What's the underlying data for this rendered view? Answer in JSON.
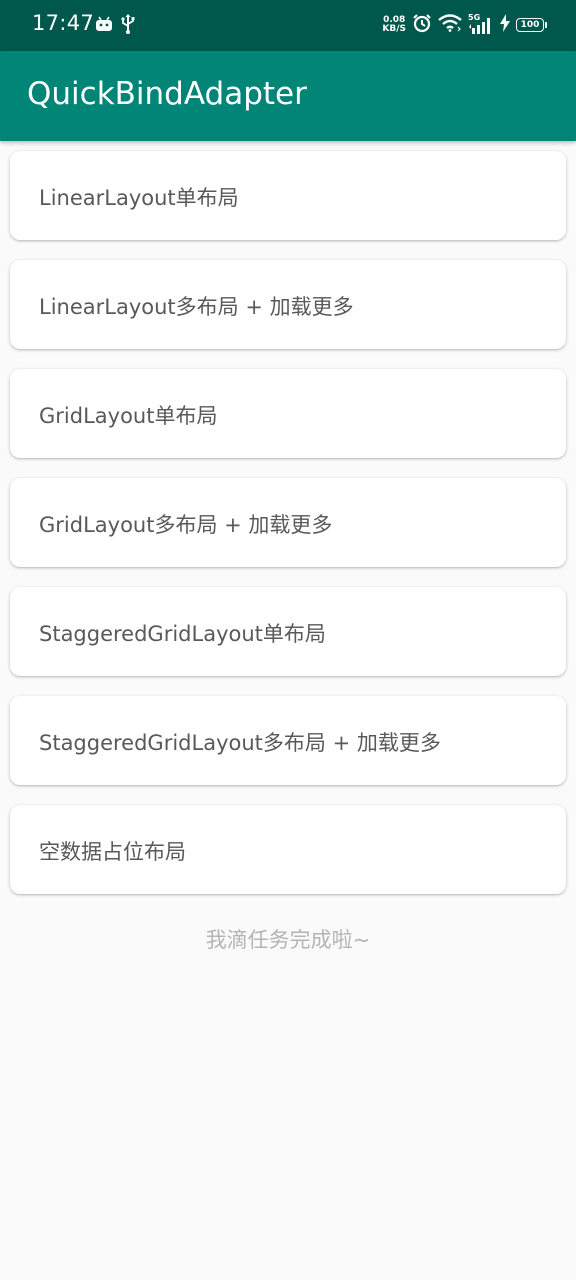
{
  "status_bar": {
    "time": "17:47",
    "net_speed_value": "0.08",
    "net_speed_unit": "KB/S",
    "network_type": "5G",
    "battery_level": "100",
    "icons": [
      "android-notification-icon",
      "usb-icon",
      "alarm-icon",
      "wifi-icon",
      "signal-icon",
      "charging-icon",
      "battery-icon"
    ]
  },
  "app_bar": {
    "title": "QuickBindAdapter"
  },
  "menu": {
    "items": [
      {
        "label": "LinearLayout单布局"
      },
      {
        "label": "LinearLayout多布局 + 加载更多"
      },
      {
        "label": "GridLayout单布局"
      },
      {
        "label": "GridLayout多布局 + 加载更多"
      },
      {
        "label": "StaggeredGridLayout单布局"
      },
      {
        "label": "StaggeredGridLayout多布局 + 加载更多"
      },
      {
        "label": "空数据占位布局"
      }
    ]
  },
  "footer": {
    "text": "我滴任务完成啦~"
  },
  "colors": {
    "status_bar": "#00574b",
    "app_bar": "#008577",
    "background": "#fafafa",
    "card": "#ffffff",
    "card_text": "#595959",
    "footer_text": "#b4b4b4"
  }
}
